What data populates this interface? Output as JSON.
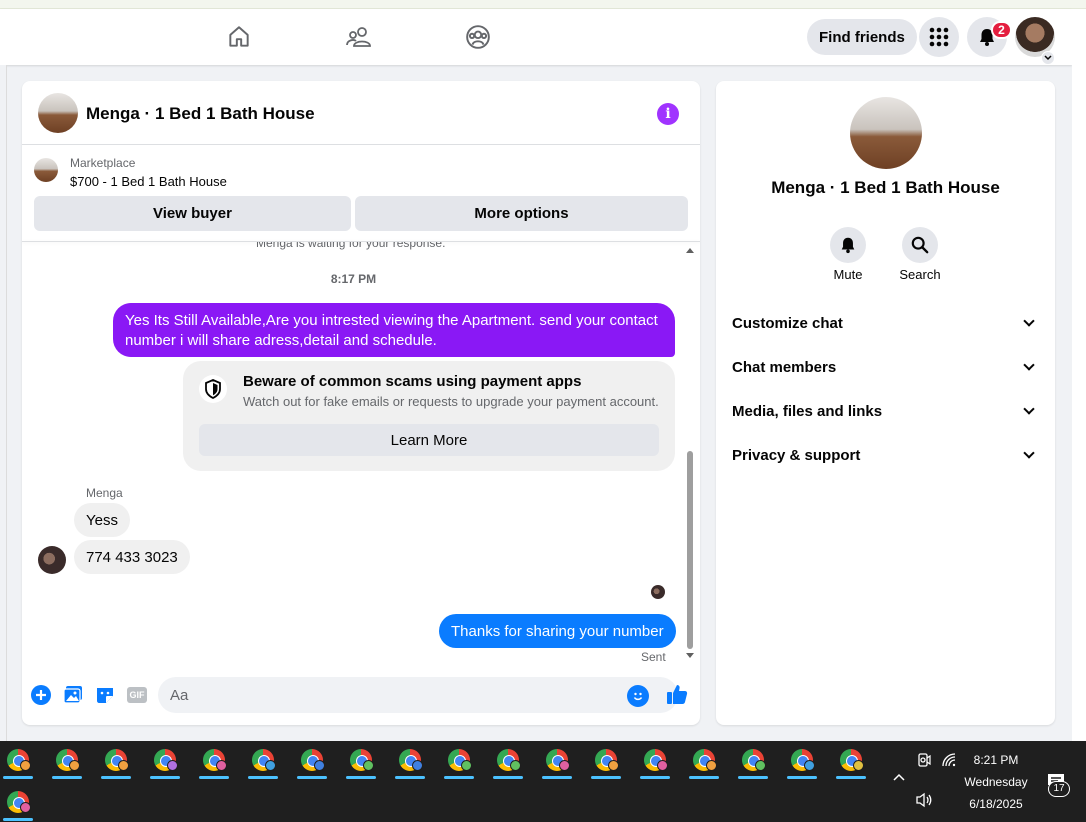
{
  "header": {
    "find_friends_label": "Find friends",
    "notification_count": "2"
  },
  "chat": {
    "title": "Menga · 1 Bed 1 Bath House",
    "marketplace_label": "Marketplace",
    "listing": "$700 - 1 Bed 1 Bath House",
    "view_buyer_label": "View buyer",
    "more_options_label": "More options",
    "waiting_text": "Menga is waiting for your response.",
    "timestamp": "8:17 PM",
    "outgoing_message_1": "Yes Its Still Available,Are you intrested viewing the Apartment. send your contact number i will share adress,detail and schedule.",
    "scam_title": "Beware of common scams using payment apps",
    "scam_subtitle": "Watch out for fake emails or requests to upgrade your payment account.",
    "learn_more_label": "Learn More",
    "sender_name": "Menga",
    "incoming_message_1": "Yess",
    "incoming_message_2": "774 433 3023",
    "outgoing_message_2": "Thanks for sharing your number",
    "status": "Sent",
    "composer_placeholder": "Aa",
    "gif_label": "GIF"
  },
  "info_panel": {
    "title": "Menga · 1 Bed 1 Bath House",
    "mute_label": "Mute",
    "search_label": "Search",
    "sections": [
      "Customize chat",
      "Chat members",
      "Media, files and links",
      "Privacy & support"
    ]
  },
  "taskbar": {
    "time": "8:21 PM",
    "day": "Wednesday",
    "date": "6/18/2025",
    "notification_count": "17"
  },
  "colors": {
    "accent_purple": "#8a18f5",
    "accent_blue": "#0a7cff",
    "notification_red": "#e41e3f"
  }
}
